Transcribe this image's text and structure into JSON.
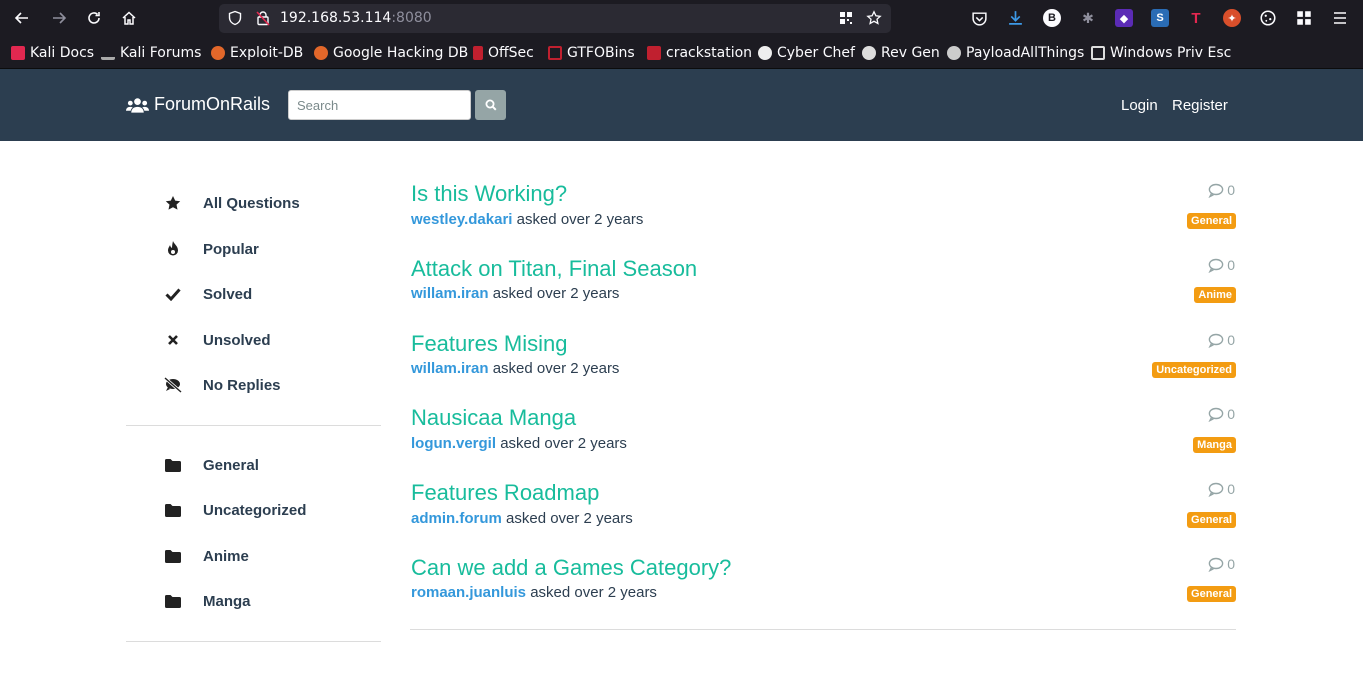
{
  "browser": {
    "url_host": "192.168.53.114",
    "url_port": ":8080",
    "bookmarks": [
      "Kali Docs",
      "Kali Forums",
      "Exploit-DB",
      "Google Hacking DB",
      "OffSec",
      "GTFOBins",
      "crackstation",
      "Cyber Chef",
      "Rev Gen",
      "PayloadAllThings",
      "Windows Priv Esc"
    ]
  },
  "navbar": {
    "brand": "ForumOnRails",
    "search_placeholder": "Search",
    "login": "Login",
    "register": "Register"
  },
  "sidebar": {
    "filters": [
      "All Questions",
      "Popular",
      "Solved",
      "Unsolved",
      "No Replies"
    ],
    "categories": [
      "General",
      "Uncategorized",
      "Anime",
      "Manga"
    ]
  },
  "questions": [
    {
      "title": "Is this Working?",
      "author": "westley.dakari",
      "time": "asked over 2 years",
      "replies": "0",
      "category": "General"
    },
    {
      "title": "Attack on Titan, Final Season",
      "author": "willam.iran",
      "time": "asked over 2 years",
      "replies": "0",
      "category": "Anime"
    },
    {
      "title": "Features Mising",
      "author": "willam.iran",
      "time": "asked over 2 years",
      "replies": "0",
      "category": "Uncategorized"
    },
    {
      "title": "Nausicaa Manga",
      "author": "logun.vergil",
      "time": "asked over 2 years",
      "replies": "0",
      "category": "Manga"
    },
    {
      "title": "Features Roadmap",
      "author": "admin.forum",
      "time": "asked over 2 years",
      "replies": "0",
      "category": "General"
    },
    {
      "title": "Can we add a Games Category?",
      "author": "romaan.juanluis",
      "time": "asked over 2 years",
      "replies": "0",
      "category": "General"
    }
  ],
  "colors": {
    "navbar_bg": "#2c3e50",
    "title": "#18bc9c",
    "author": "#3498db",
    "badge": "#f39c12"
  }
}
